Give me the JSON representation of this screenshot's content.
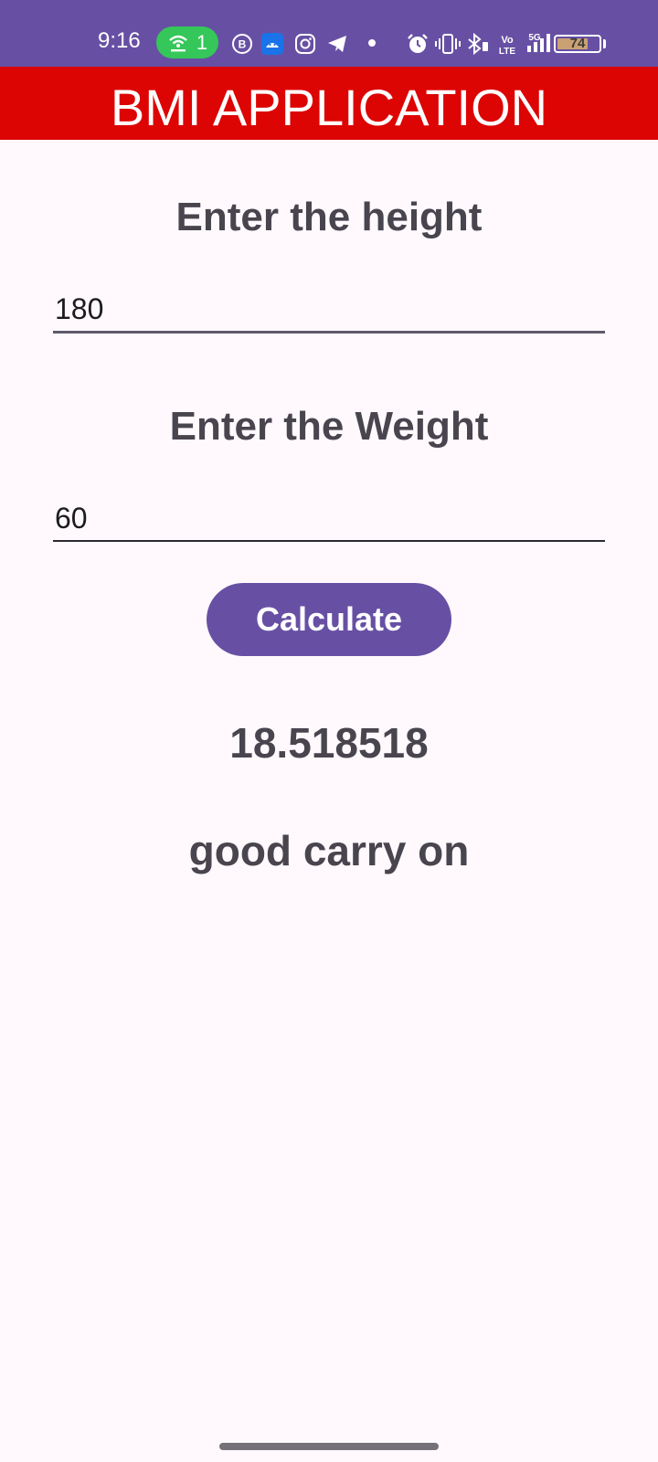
{
  "status_bar": {
    "time": "9:16",
    "hotspot_count": "1",
    "battery_level": "74",
    "network": "5G",
    "volte": "Vo LTE",
    "background_color": "#6750A4"
  },
  "app_bar": {
    "title": "BMI APPLICATION",
    "background_color": "#DD0404"
  },
  "form": {
    "height_label": "Enter the height",
    "height_value": "180",
    "weight_label": "Enter the Weight",
    "weight_value": "60",
    "calculate_label": "Calculate"
  },
  "result": {
    "bmi_value": "18.518518",
    "message": "good carry on"
  },
  "colors": {
    "accent": "#6750A4",
    "label_text": "#49454F",
    "page_background": "#FFF9FD"
  },
  "icons": {
    "status_icons": [
      "hotspot-icon",
      "business-chat-icon",
      "android-app-icon",
      "instagram-icon",
      "telegram-icon",
      "notification-dot-icon",
      "alarm-icon",
      "vibrate-icon",
      "bluetooth-icon",
      "volte-icon",
      "signal-icon",
      "battery-icon"
    ]
  }
}
